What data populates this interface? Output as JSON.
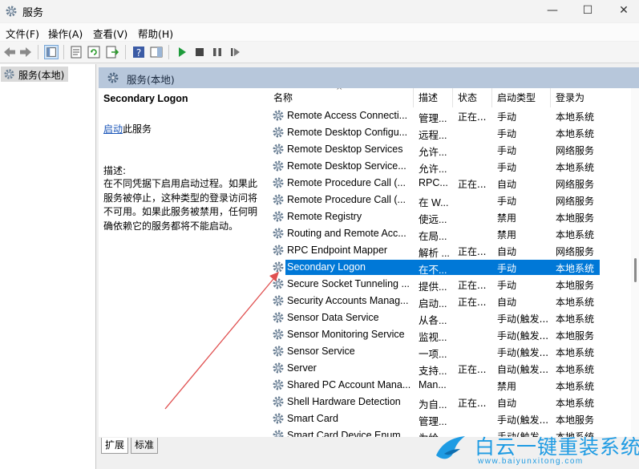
{
  "window": {
    "title": "服务",
    "min_icon": "minimize-icon",
    "max_icon": "maximize-icon",
    "close_icon": "close-icon"
  },
  "menu": [
    "文件(F)",
    "操作(A)",
    "查看(V)",
    "帮助(H)"
  ],
  "toolbar_icons": [
    "back-arrow-icon",
    "forward-arrow-icon",
    "show-hide-tree-icon",
    "properties-icon",
    "refresh-icon",
    "export-list-icon",
    "help-icon",
    "show-action-pane-icon",
    "start-service-icon",
    "stop-service-icon",
    "pause-service-icon",
    "restart-service-icon"
  ],
  "tree": {
    "root": "服务(本地)"
  },
  "panel": {
    "header": "服务(本地)"
  },
  "description": {
    "service_name": "Secondary Logon",
    "start_link": "启动",
    "start_suffix": "此服务",
    "label": "描述:",
    "text": "在不同凭据下启用启动过程。如果此服务被停止，这种类型的登录访问将不可用。如果此服务被禁用，任何明确依赖它的服务都将不能启动。"
  },
  "columns": [
    "名称",
    "描述",
    "状态",
    "启动类型",
    "登录为"
  ],
  "rows": [
    {
      "name": "Remote Access Connecti...",
      "desc": "管理...",
      "status": "正在...",
      "startup": "手动",
      "logon": "本地系统"
    },
    {
      "name": "Remote Desktop Configu...",
      "desc": "远程...",
      "status": "",
      "startup": "手动",
      "logon": "本地系统"
    },
    {
      "name": "Remote Desktop Services",
      "desc": "允许...",
      "status": "",
      "startup": "手动",
      "logon": "网络服务"
    },
    {
      "name": "Remote Desktop Service...",
      "desc": "允许...",
      "status": "",
      "startup": "手动",
      "logon": "本地系统"
    },
    {
      "name": "Remote Procedure Call (...",
      "desc": "RPC...",
      "status": "正在...",
      "startup": "自动",
      "logon": "网络服务"
    },
    {
      "name": "Remote Procedure Call (...",
      "desc": "在 W...",
      "status": "",
      "startup": "手动",
      "logon": "网络服务"
    },
    {
      "name": "Remote Registry",
      "desc": "使远...",
      "status": "",
      "startup": "禁用",
      "logon": "本地服务"
    },
    {
      "name": "Routing and Remote Acc...",
      "desc": "在局...",
      "status": "",
      "startup": "禁用",
      "logon": "本地系统"
    },
    {
      "name": "RPC Endpoint Mapper",
      "desc": "解析 ...",
      "status": "正在...",
      "startup": "自动",
      "logon": "网络服务"
    },
    {
      "name": "Secondary Logon",
      "desc": "在不...",
      "status": "",
      "startup": "手动",
      "logon": "本地系统",
      "selected": true
    },
    {
      "name": "Secure Socket Tunneling ...",
      "desc": "提供...",
      "status": "正在...",
      "startup": "手动",
      "logon": "本地服务"
    },
    {
      "name": "Security Accounts Manag...",
      "desc": "启动...",
      "status": "正在...",
      "startup": "自动",
      "logon": "本地系统"
    },
    {
      "name": "Sensor Data Service",
      "desc": "从各...",
      "status": "",
      "startup": "手动(触发...",
      "logon": "本地系统"
    },
    {
      "name": "Sensor Monitoring Service",
      "desc": "监视...",
      "status": "",
      "startup": "手动(触发...",
      "logon": "本地服务"
    },
    {
      "name": "Sensor Service",
      "desc": "一项...",
      "status": "",
      "startup": "手动(触发...",
      "logon": "本地系统"
    },
    {
      "name": "Server",
      "desc": "支持...",
      "status": "正在...",
      "startup": "自动(触发...",
      "logon": "本地系统"
    },
    {
      "name": "Shared PC Account Mana...",
      "desc": "Man...",
      "status": "",
      "startup": "禁用",
      "logon": "本地系统"
    },
    {
      "name": "Shell Hardware Detection",
      "desc": "为自...",
      "status": "正在...",
      "startup": "自动",
      "logon": "本地系统"
    },
    {
      "name": "Smart Card",
      "desc": "管理...",
      "status": "",
      "startup": "手动(触发...",
      "logon": "本地服务"
    },
    {
      "name": "Smart Card Device Enum...",
      "desc": "为给...",
      "status": "",
      "startup": "手动(触发...",
      "logon": "本地系统"
    }
  ],
  "tabs": [
    "扩展",
    "标准"
  ],
  "watermark": {
    "text": "白云一键重装系统",
    "url": "www.baiyunxitong.com"
  },
  "colors": {
    "selection": "#0078d7",
    "header_band": "#b7c7db",
    "link": "#1a55b8",
    "arrow": "#e05050",
    "watermark": "#1e9be3"
  }
}
